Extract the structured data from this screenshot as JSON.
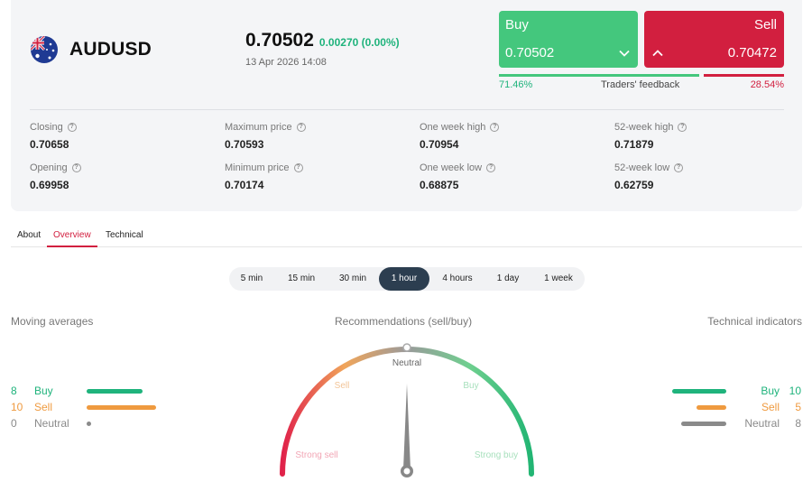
{
  "instrument": {
    "symbol": "AUDUSD",
    "price": "0.70502",
    "change": "0.00270 (0.00%)",
    "timestamp": "13 Apr 2026 14:08"
  },
  "trade": {
    "buy_label": "Buy",
    "buy_price": "0.70502",
    "sell_label": "Sell",
    "sell_price": "0.70472"
  },
  "feedback": {
    "buy_pct": "71.46%",
    "label": "Traders' feedback",
    "sell_pct": "28.54%",
    "buy_share": 0.7146
  },
  "stats": [
    {
      "label": "Closing",
      "value": "0.70658"
    },
    {
      "label": "Maximum price",
      "value": "0.70593"
    },
    {
      "label": "One week high",
      "value": "0.70954"
    },
    {
      "label": "52-week high",
      "value": "0.71879"
    },
    {
      "label": "Opening",
      "value": "0.69958"
    },
    {
      "label": "Minimum price",
      "value": "0.70174"
    },
    {
      "label": "One week low",
      "value": "0.68875"
    },
    {
      "label": "52-week low",
      "value": "0.62759"
    }
  ],
  "tabs": [
    {
      "label": "About"
    },
    {
      "label": "Overview",
      "active": true
    },
    {
      "label": "Technical"
    }
  ],
  "periods": [
    {
      "label": "5 min"
    },
    {
      "label": "15 min"
    },
    {
      "label": "30 min"
    },
    {
      "label": "1 hour",
      "active": true
    },
    {
      "label": "4 hours"
    },
    {
      "label": "1 day"
    },
    {
      "label": "1 week"
    }
  ],
  "moving_averages": {
    "title": "Moving averages",
    "buy": {
      "count": "8",
      "label": "Buy"
    },
    "sell": {
      "count": "10",
      "label": "Sell"
    },
    "neutral": {
      "count": "0",
      "label": "Neutral"
    }
  },
  "technical_indicators": {
    "title": "Technical indicators",
    "buy": {
      "count": "10",
      "label": "Buy"
    },
    "sell": {
      "count": "5",
      "label": "Sell"
    },
    "neutral": {
      "count": "8",
      "label": "Neutral"
    }
  },
  "recommendation": {
    "title": "Recommendations (sell/buy)",
    "labels": {
      "neutral": "Neutral",
      "sell": "Sell",
      "buy": "Buy",
      "strong_sell": "Strong sell",
      "strong_buy": "Strong buy"
    },
    "needle_value": 0.0
  },
  "colors": {
    "buy": "#44c77d",
    "sell": "#d21f3f",
    "ma_buy": "#1fb37c",
    "ma_sell": "#ef9a3f",
    "neutral": "#8a8a8a"
  },
  "icons": {
    "flag": "australia-flag-icon",
    "help": "question-circle-icon",
    "buy_chevron": "chevron-down-icon",
    "sell_chevron": "chevron-up-icon"
  }
}
